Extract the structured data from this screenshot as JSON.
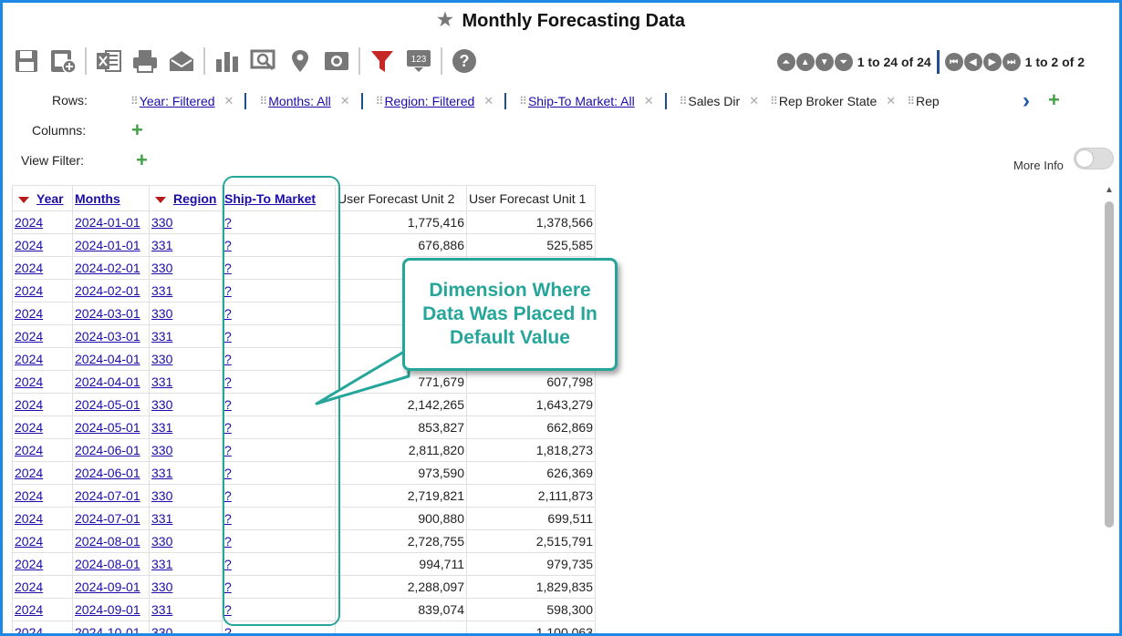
{
  "title": "Monthly Forecasting Data",
  "toolbar": {
    "icons": [
      "save-icon",
      "save-as-icon",
      "excel-export-icon",
      "print-icon",
      "email-icon",
      "bar-chart-icon",
      "presentation-icon",
      "map-pin-icon",
      "zoom-report-icon",
      "filter-icon",
      "number-format-icon",
      "help-icon"
    ]
  },
  "pager": {
    "rows_text": "1 to 24 of 24",
    "cols_text": "1 to 2 of 2"
  },
  "layout_bar": {
    "rows_label": "Rows:",
    "columns_label": "Columns:",
    "view_filter_label": "View Filter:",
    "chips": [
      {
        "label": "Year: Filtered",
        "link": true
      },
      {
        "label": "Months: All",
        "link": true
      },
      {
        "label": "Region: Filtered",
        "link": true
      },
      {
        "label": "Ship-To Market: All",
        "link": true
      },
      {
        "label": "Sales Dir",
        "link": false
      },
      {
        "label": "Rep Broker State",
        "link": false
      },
      {
        "label": "Rep",
        "link": false
      }
    ]
  },
  "more_info_label": "More Info",
  "table": {
    "headers": [
      "Year",
      "Months",
      "Region",
      "Ship-To Market",
      "User Forecast Unit 2",
      "User Forecast Unit 1"
    ],
    "rows": [
      [
        "2024",
        "2024-01-01",
        "330",
        "?",
        "1,775,416",
        "1,378,566"
      ],
      [
        "2024",
        "2024-01-01",
        "331",
        "?",
        "676,886",
        "525,585"
      ],
      [
        "2024",
        "2024-02-01",
        "330",
        "?",
        "",
        ""
      ],
      [
        "2024",
        "2024-02-01",
        "331",
        "?",
        "",
        ""
      ],
      [
        "2024",
        "2024-03-01",
        "330",
        "?",
        "",
        ""
      ],
      [
        "2024",
        "2024-03-01",
        "331",
        "?",
        "",
        ""
      ],
      [
        "2024",
        "2024-04-01",
        "330",
        "?",
        "",
        ""
      ],
      [
        "2024",
        "2024-04-01",
        "331",
        "?",
        "771,679",
        "607,798"
      ],
      [
        "2024",
        "2024-05-01",
        "330",
        "?",
        "2,142,265",
        "1,643,279"
      ],
      [
        "2024",
        "2024-05-01",
        "331",
        "?",
        "853,827",
        "662,869"
      ],
      [
        "2024",
        "2024-06-01",
        "330",
        "?",
        "2,811,820",
        "1,818,273"
      ],
      [
        "2024",
        "2024-06-01",
        "331",
        "?",
        "973,590",
        "626,369"
      ],
      [
        "2024",
        "2024-07-01",
        "330",
        "?",
        "2,719,821",
        "2,111,873"
      ],
      [
        "2024",
        "2024-07-01",
        "331",
        "?",
        "900,880",
        "699,511"
      ],
      [
        "2024",
        "2024-08-01",
        "330",
        "?",
        "2,728,755",
        "2,515,791"
      ],
      [
        "2024",
        "2024-08-01",
        "331",
        "?",
        "994,711",
        "979,735"
      ],
      [
        "2024",
        "2024-09-01",
        "330",
        "?",
        "2,288,097",
        "1,829,835"
      ],
      [
        "2024",
        "2024-09-01",
        "331",
        "?",
        "839,074",
        "598,300"
      ],
      [
        "2024",
        "2024-10-01",
        "330",
        "?",
        "",
        "1,100,063"
      ]
    ]
  },
  "callout_text": "Dimension Where Data Was Placed In Default Value",
  "colors": {
    "accent_teal": "#26a69a",
    "link_blue": "#1a0dab",
    "filter_red": "#b71c1c",
    "add_green": "#43a047"
  }
}
